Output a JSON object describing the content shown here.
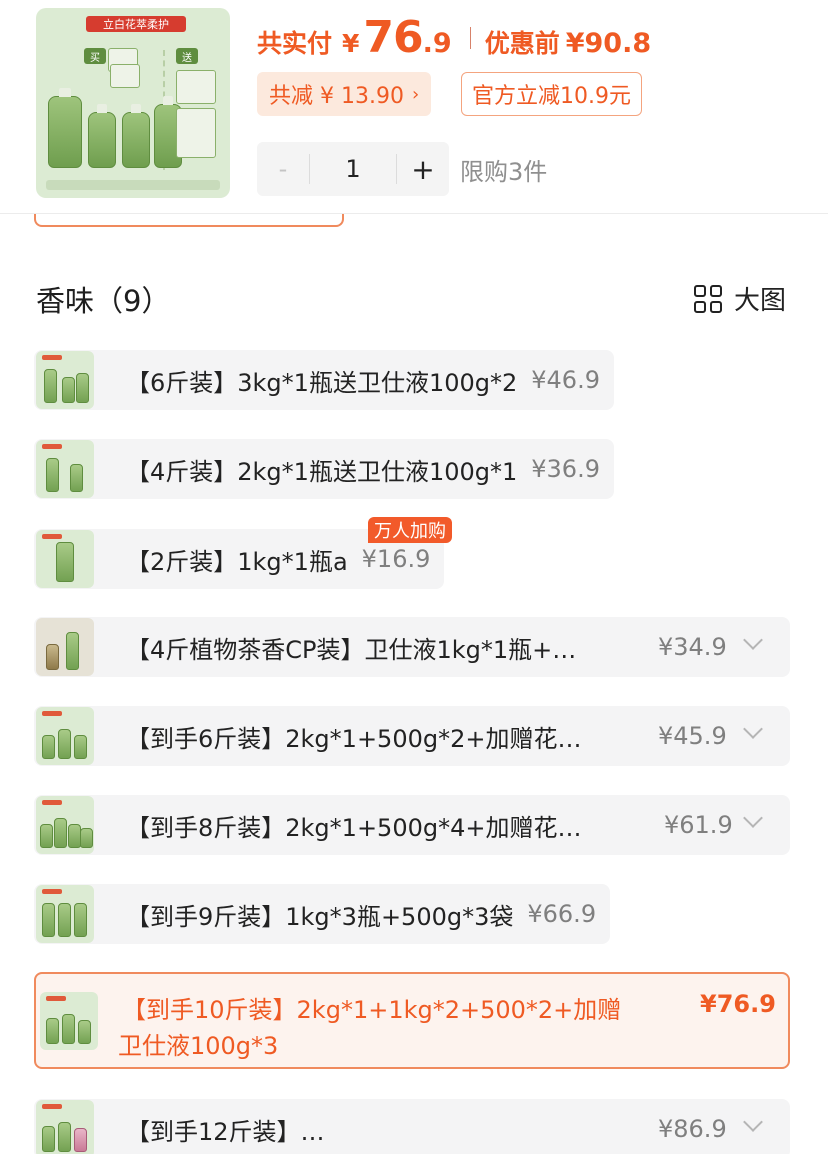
{
  "header": {
    "price_label": "共实付",
    "currency": "¥",
    "price_integer": "76",
    "price_decimal": ".9",
    "original_label": "优惠前",
    "original_price": "¥90.8",
    "discount_total": "共减 ¥ 13.90",
    "discount_arrow": "›",
    "official_discount": "官方立减10.9元",
    "stepper": {
      "minus": "-",
      "quantity": "1",
      "plus": "+"
    },
    "limit_text": "限购3件",
    "thumbnail": {
      "brand": "立白花萃柔护",
      "buy_tag": "买",
      "gift_tag": "送"
    }
  },
  "section": {
    "title": "香味（9）",
    "big_image_label": "大图"
  },
  "options": [
    {
      "text": "【6斤装】3kg*1瓶送卫仕液100g*2",
      "price": "¥46.9"
    },
    {
      "text": "【4斤装】2kg*1瓶送卫仕液100g*1",
      "price": "¥36.9"
    },
    {
      "text": "【2斤装】1kg*1瓶a",
      "price": "¥16.9",
      "badge": "万人加购"
    },
    {
      "text": "【4斤植物茶香CP装】卫仕液1kg*1瓶+…",
      "price": "¥34.9"
    },
    {
      "text": "【到手6斤装】2kg*1+500g*2+加赠花…",
      "price": "¥45.9"
    },
    {
      "text": "【到手8斤装】2kg*1+500g*4+加赠花…",
      "price": "¥61.9"
    },
    {
      "text": "【到手9斤装】1kg*3瓶+500g*3袋",
      "price": "¥66.9"
    },
    {
      "text_line1": "【到手10斤装】2kg*1+1kg*2+500*2+加赠",
      "text_line2": "卫仕液100g*3",
      "price": "¥76.9",
      "selected": true
    },
    {
      "text": "【到手12斤装】…",
      "price": "¥86.9"
    }
  ],
  "colors": {
    "accent": "#ef5a23",
    "accent_border": "#f08a5d",
    "accent_bg": "#fce9dd",
    "option_bg": "#f4f4f5",
    "product_green": "#6f9e4e"
  }
}
